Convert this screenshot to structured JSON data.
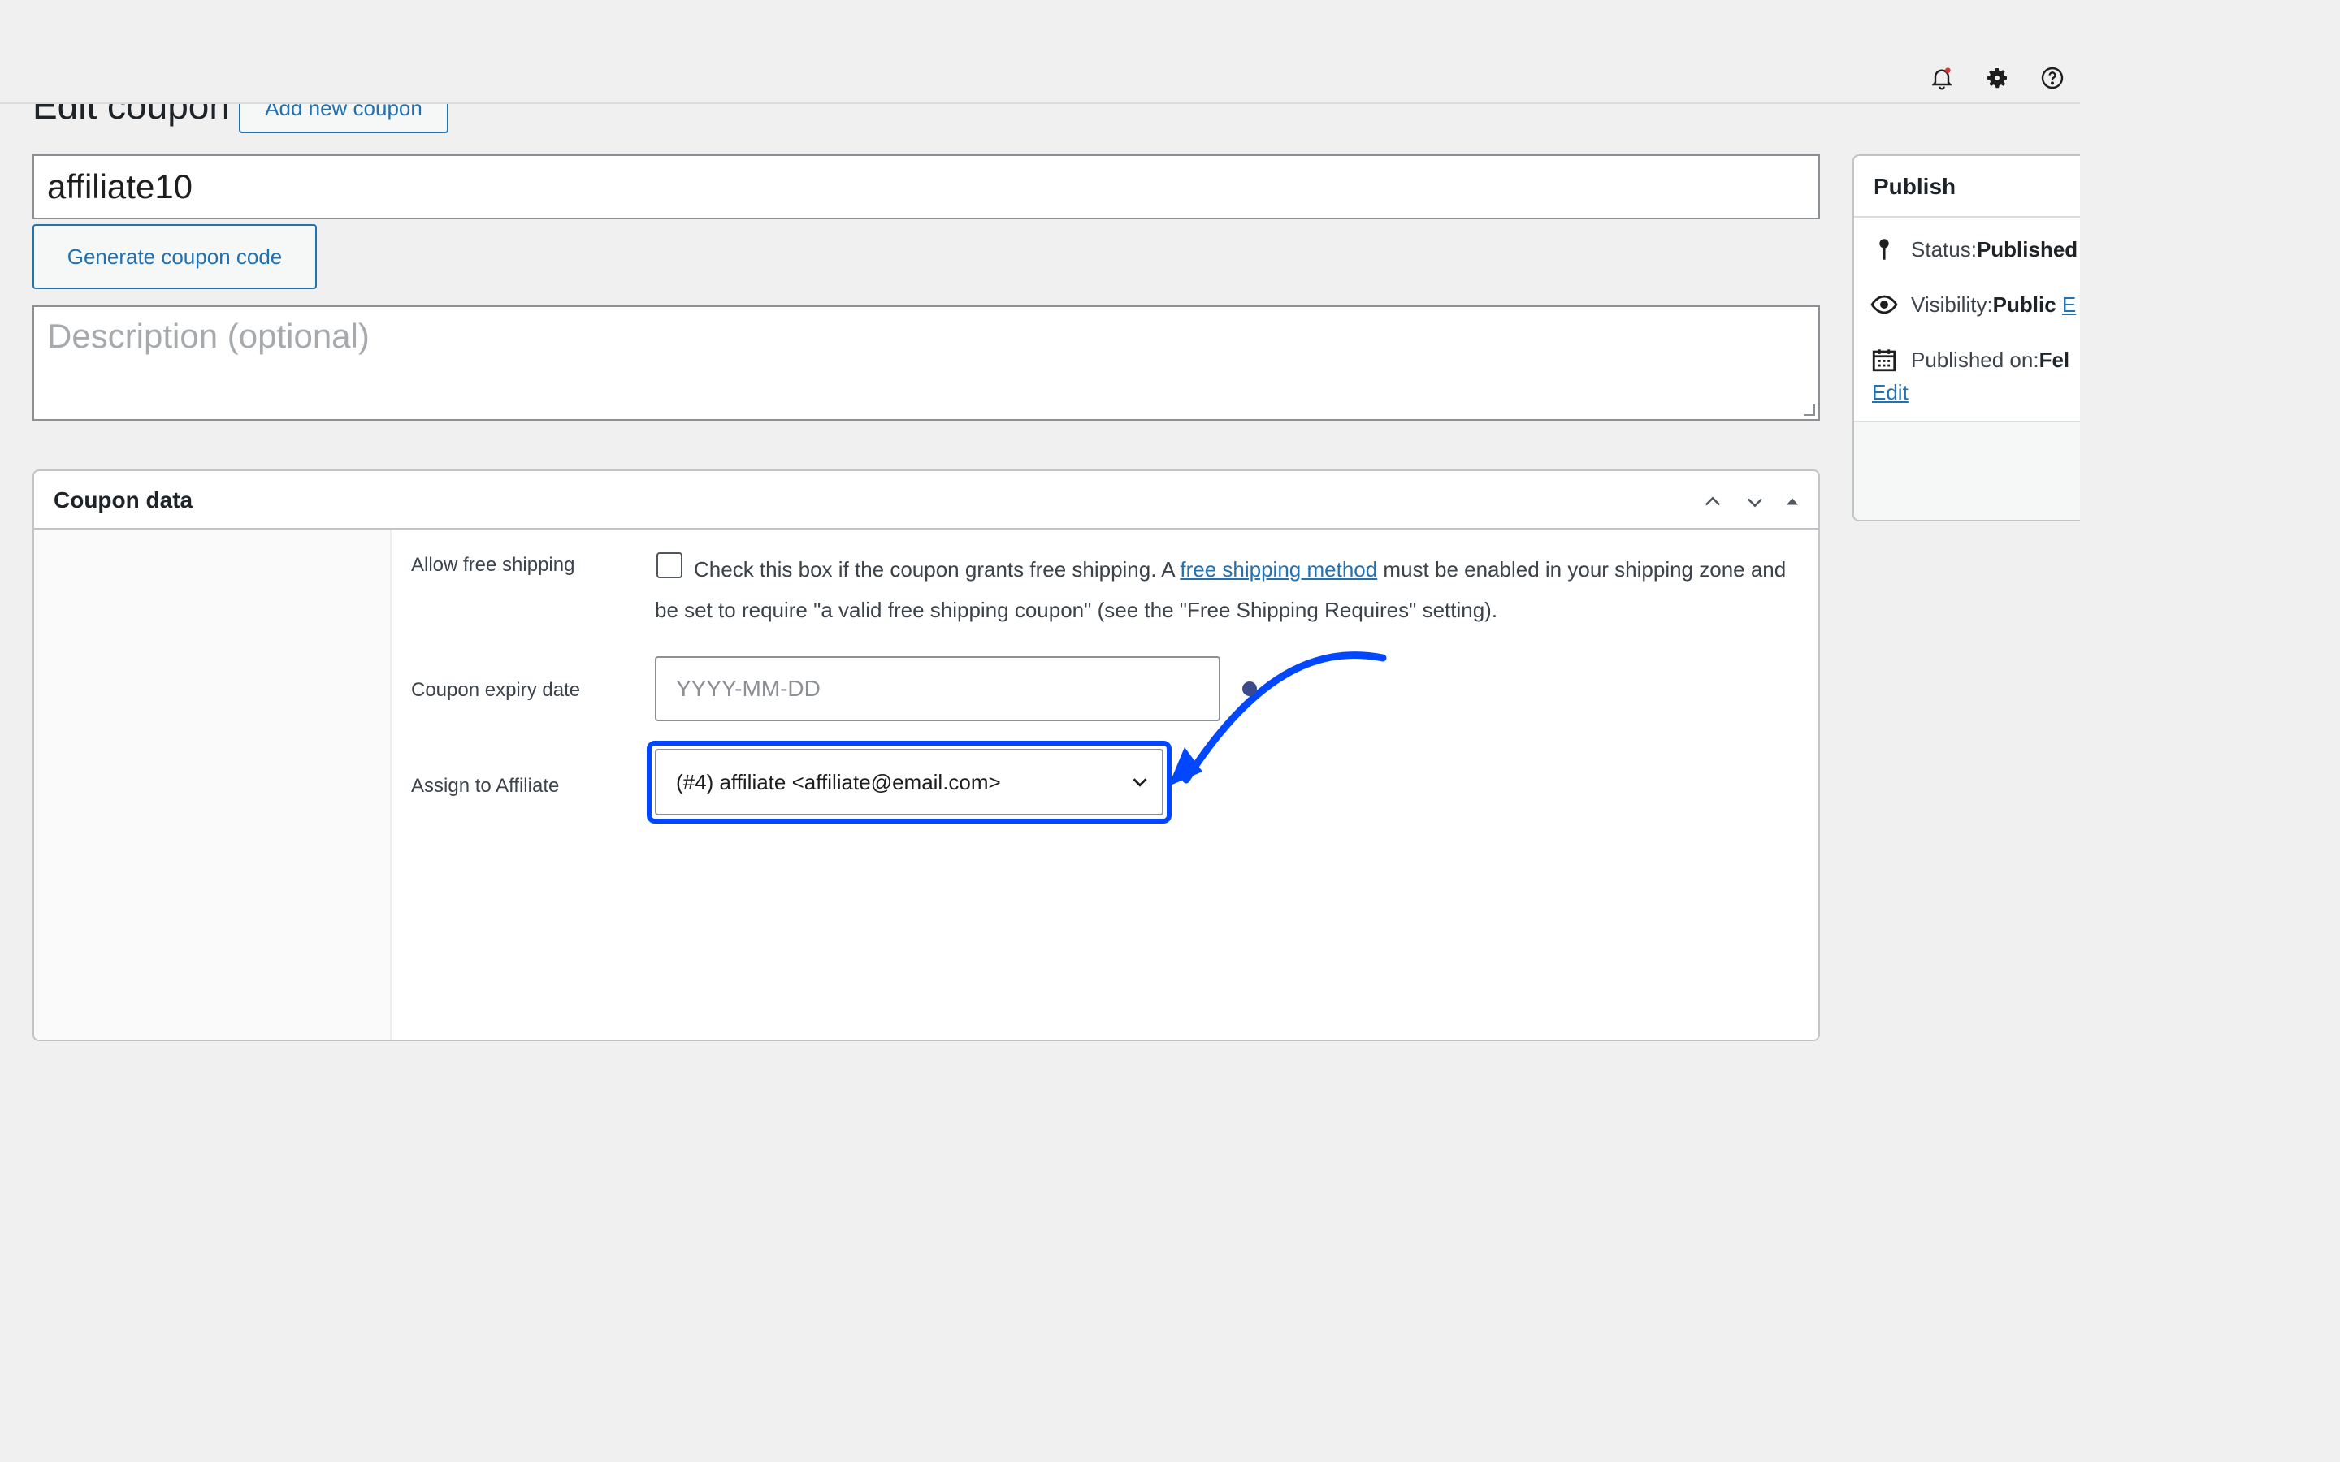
{
  "header": {
    "title": "Edit coupon",
    "add_new_label": "Add new coupon",
    "icons": [
      "bell-icon",
      "gear-icon",
      "help-icon"
    ]
  },
  "coupon": {
    "code": "affiliate10",
    "generate_label": "Generate coupon code",
    "description_placeholder": "Description (optional)"
  },
  "coupon_data": {
    "title": "Coupon data",
    "free_shipping_label": "Allow free shipping",
    "free_shipping_text_before": "Check this box if the coupon grants free shipping. A ",
    "free_shipping_link": "free shipping method",
    "free_shipping_text_after": " must be enabled in your shipping zone and be set to require \"a valid free shipping coupon\" (see the \"Free Shipping Requires\" setting).",
    "expiry_label": "Coupon expiry date",
    "expiry_placeholder": "YYYY-MM-DD",
    "affiliate_label": "Assign to Affiliate",
    "affiliate_value": "(#4) affiliate <affiliate@email.com>"
  },
  "publish": {
    "title": "Publish",
    "status_label": "Status: ",
    "status_value": "Published",
    "visibility_label": "Visibility: ",
    "visibility_value": "Public",
    "visibility_edit": "E",
    "published_label": "Published on: ",
    "published_value": "Fel",
    "edit_label": "Edit"
  },
  "colors": {
    "accent": "#2271b1",
    "highlight": "#0047ff",
    "background": "#f0f0f1"
  }
}
